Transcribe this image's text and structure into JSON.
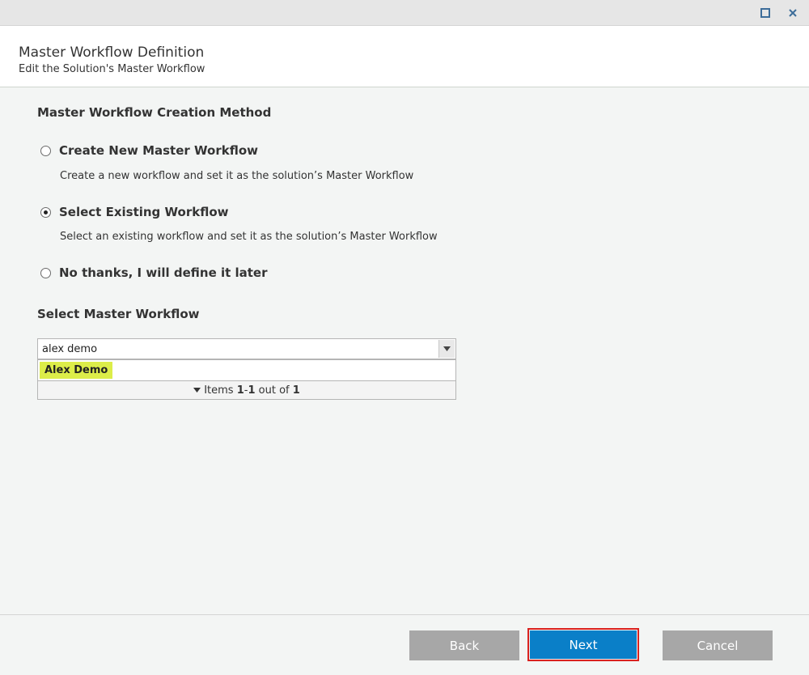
{
  "header": {
    "title": "Master Workflow Definition",
    "subtitle": "Edit the Solution's Master Workflow"
  },
  "window_controls": {
    "maximize_icon": "maximize-icon",
    "close_icon": "close-icon"
  },
  "creation_method": {
    "title": "Master Workflow Creation Method",
    "options": [
      {
        "label": "Create New Master Workflow",
        "description": "Create a new workflow and set it as the solution’s Master Workflow",
        "selected": false
      },
      {
        "label": "Select Existing Workflow",
        "description": "Select an existing workflow and set it as the solution’s Master Workflow",
        "selected": true
      },
      {
        "label": "No thanks, I will define it later",
        "description": "",
        "selected": false
      }
    ]
  },
  "select_workflow": {
    "title": "Select Master Workflow",
    "input_value": "alex demo",
    "dropdown_items": [
      "Alex Demo"
    ],
    "footer": {
      "prefix": "Items ",
      "range_start": "1",
      "range_sep": "-",
      "range_end": "1",
      "mid": " out of ",
      "total": "1"
    }
  },
  "buttons": {
    "back": "Back",
    "next": "Next",
    "cancel": "Cancel"
  },
  "colors": {
    "primary": "#0a7fc8",
    "secondary": "#a7a7a7",
    "highlight": "#dced49",
    "focus_border": "#d9221f"
  }
}
